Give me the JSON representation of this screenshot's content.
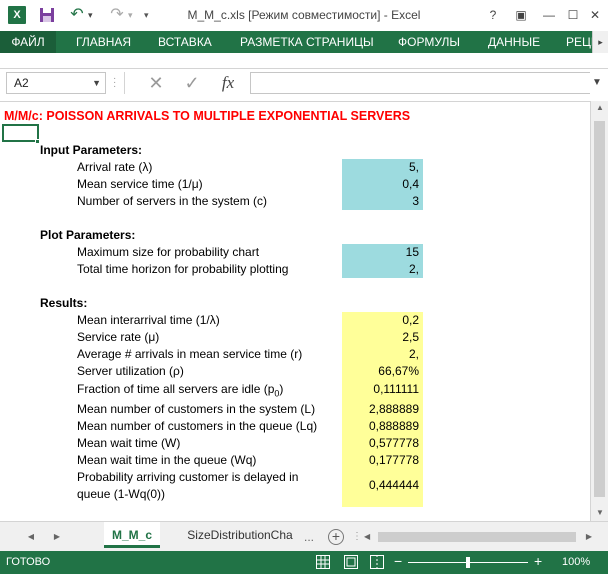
{
  "window": {
    "title": "M_M_c.xls  [Режим совместимости] - Excel",
    "app_icon": "excel-icon"
  },
  "quick_access": {
    "undo_icon": "undo-icon",
    "redo_icon": "redo-icon"
  },
  "ribbon": {
    "tabs": [
      "ФАЙЛ",
      "ГЛАВНАЯ",
      "ВСТАВКА",
      "РАЗМЕТКА СТРАНИЦЫ",
      "ФОРМУЛЫ",
      "ДАННЫЕ",
      "РЕЦЕ"
    ]
  },
  "formula_bar": {
    "name_box": "A2",
    "fx_label": "fx",
    "formula": ""
  },
  "sheet": {
    "title": "M/M/c: POISSON ARRIVALS TO MULTIPLE EXPONENTIAL SERVERS",
    "input_header": "Input Parameters:",
    "inputs": [
      {
        "label": "Arrival rate (λ)",
        "value": "5,"
      },
      {
        "label": "Mean service time (1/μ)",
        "value": "0,4"
      },
      {
        "label": "Number of servers in the system (c)",
        "value": "3"
      }
    ],
    "plot_header": "Plot Parameters:",
    "plots": [
      {
        "label": "Maximum size for probability chart",
        "value": "15"
      },
      {
        "label": "Total time horizon for probability plotting",
        "value": "2,"
      }
    ],
    "results_header": "Results:",
    "results": [
      {
        "label": "Mean interarrival time (1/λ)",
        "value": "0,2"
      },
      {
        "label": "Service rate (μ)",
        "value": "2,5"
      },
      {
        "label": "Average # arrivals in mean service time (r)",
        "value": "2,"
      },
      {
        "label": "Server utilization (ρ)",
        "value": "66,67%"
      },
      {
        "label": "Fraction of time all servers are idle (p",
        "label_sub": "0",
        "label_tail": ")",
        "value": "0,111111"
      },
      {
        "label": "Mean number of customers in the system (L)",
        "value": "2,888889"
      },
      {
        "label": "Mean number of customers in the queue (Lq)",
        "value": "0,888889"
      },
      {
        "label": "Mean wait time (W)",
        "value": "0,577778"
      },
      {
        "label": "Mean wait time in the queue (Wq)",
        "value": "0,177778"
      },
      {
        "label": "Probability arriving customer is delayed in",
        "label2": "queue (1-Wq(0))",
        "value": "0,444444"
      }
    ]
  },
  "sheet_tabs": {
    "active": "M_M_c",
    "other": "SizeDistributionCha",
    "more": "..."
  },
  "status_bar": {
    "status": "ГОТОВО",
    "zoom": "100%",
    "zoom_fraction": 0.5
  },
  "colors": {
    "brand": "#217346",
    "input_fill": "#9ddbdf",
    "result_fill": "#ffff99",
    "title_red": "#ff0000"
  }
}
